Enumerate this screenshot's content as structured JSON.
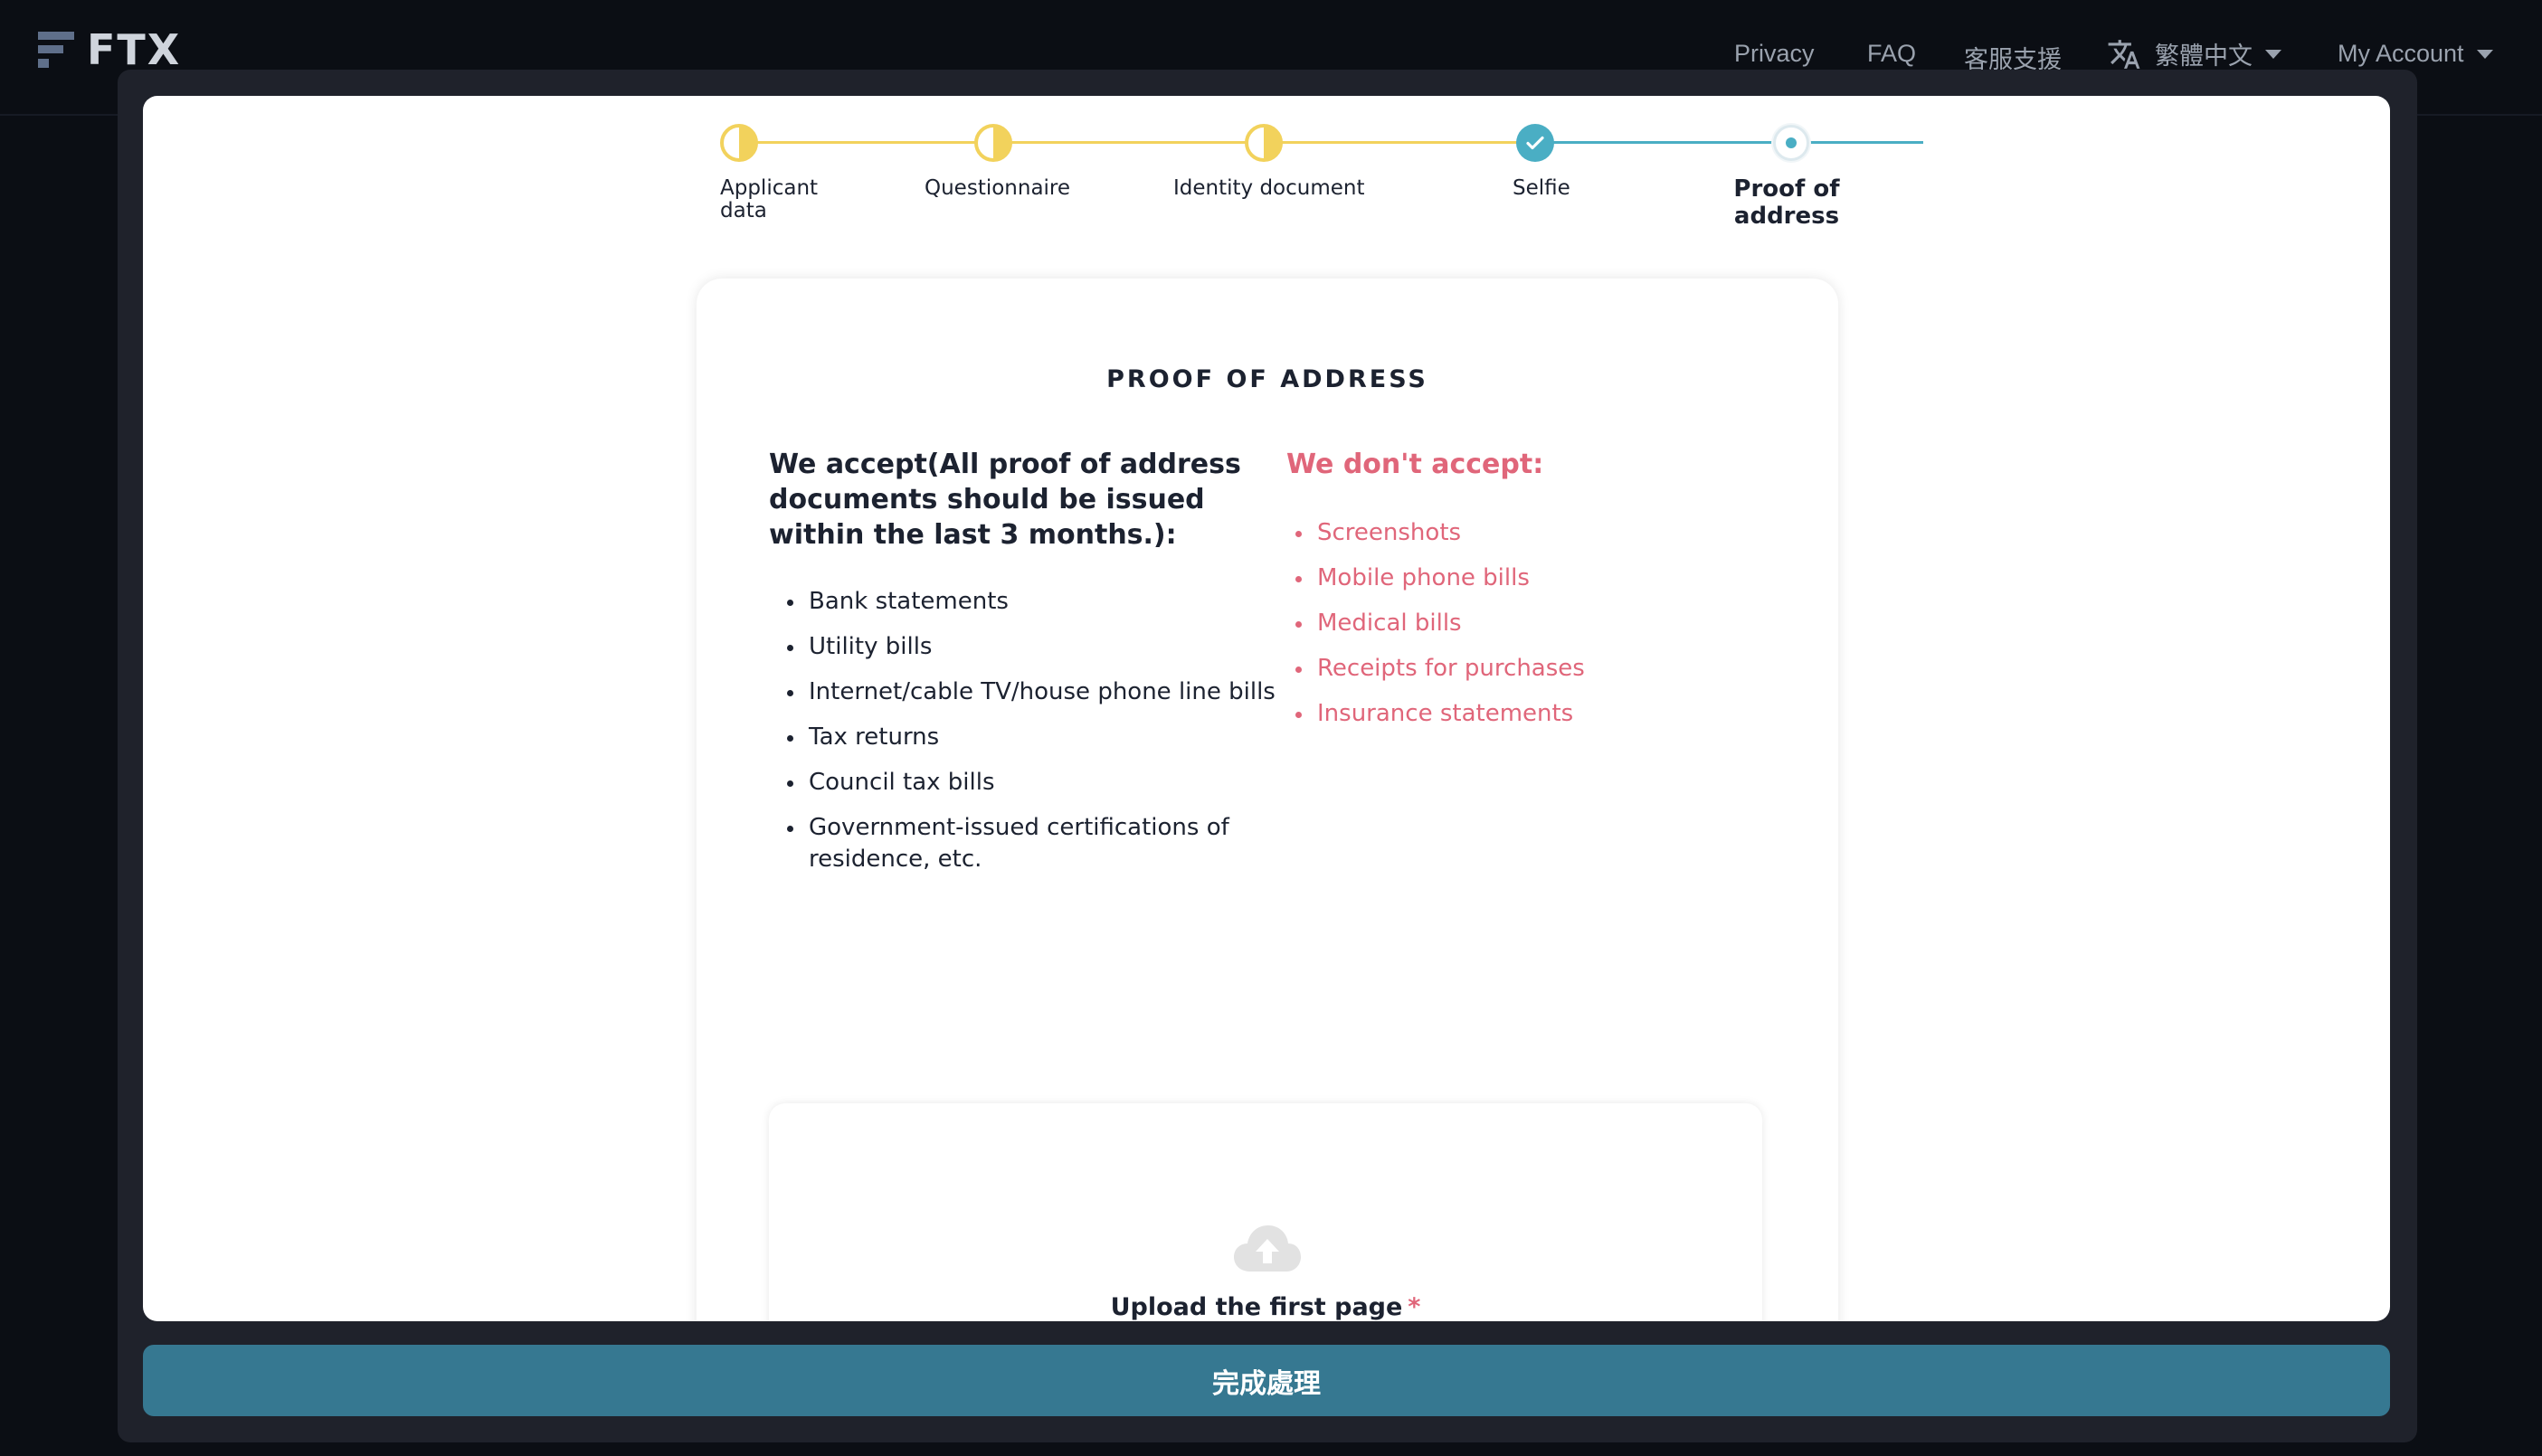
{
  "nav": {
    "logo_text": "FTX",
    "links": {
      "privacy": "Privacy",
      "faq": "FAQ",
      "support": "客服支援",
      "language": "繁體中文",
      "account": "My Account"
    }
  },
  "stepper": {
    "steps": [
      {
        "label": "Applicant data",
        "state": "partial"
      },
      {
        "label": "Questionnaire",
        "state": "partial"
      },
      {
        "label": "Identity document",
        "state": "partial"
      },
      {
        "label": "Selfie",
        "state": "done"
      },
      {
        "label": "Proof of address",
        "state": "current"
      }
    ]
  },
  "card": {
    "title": "PROOF OF ADDRESS",
    "accept_heading": "We accept(All proof of address documents should be issued within the last 3 months.):",
    "accept_items": [
      "Bank statements",
      "Utility bills",
      "Internet/cable TV/house phone line bills",
      "Tax returns",
      "Council tax bills",
      "Government-issued certifications of residence, etc."
    ],
    "reject_heading": "We don't accept:",
    "reject_items": [
      "Screenshots",
      "Mobile phone bills",
      "Medical bills",
      "Receipts for purchases",
      "Insurance statements"
    ],
    "upload": {
      "label": "Upload the first page",
      "required_mark": "*"
    }
  },
  "footer": {
    "finish_label": "完成處理"
  },
  "colors": {
    "accent": "#367891",
    "step_partial": "#f2d25c",
    "step_done": "#4aaec4",
    "reject": "#e0667a",
    "background": "#0b0e14"
  }
}
